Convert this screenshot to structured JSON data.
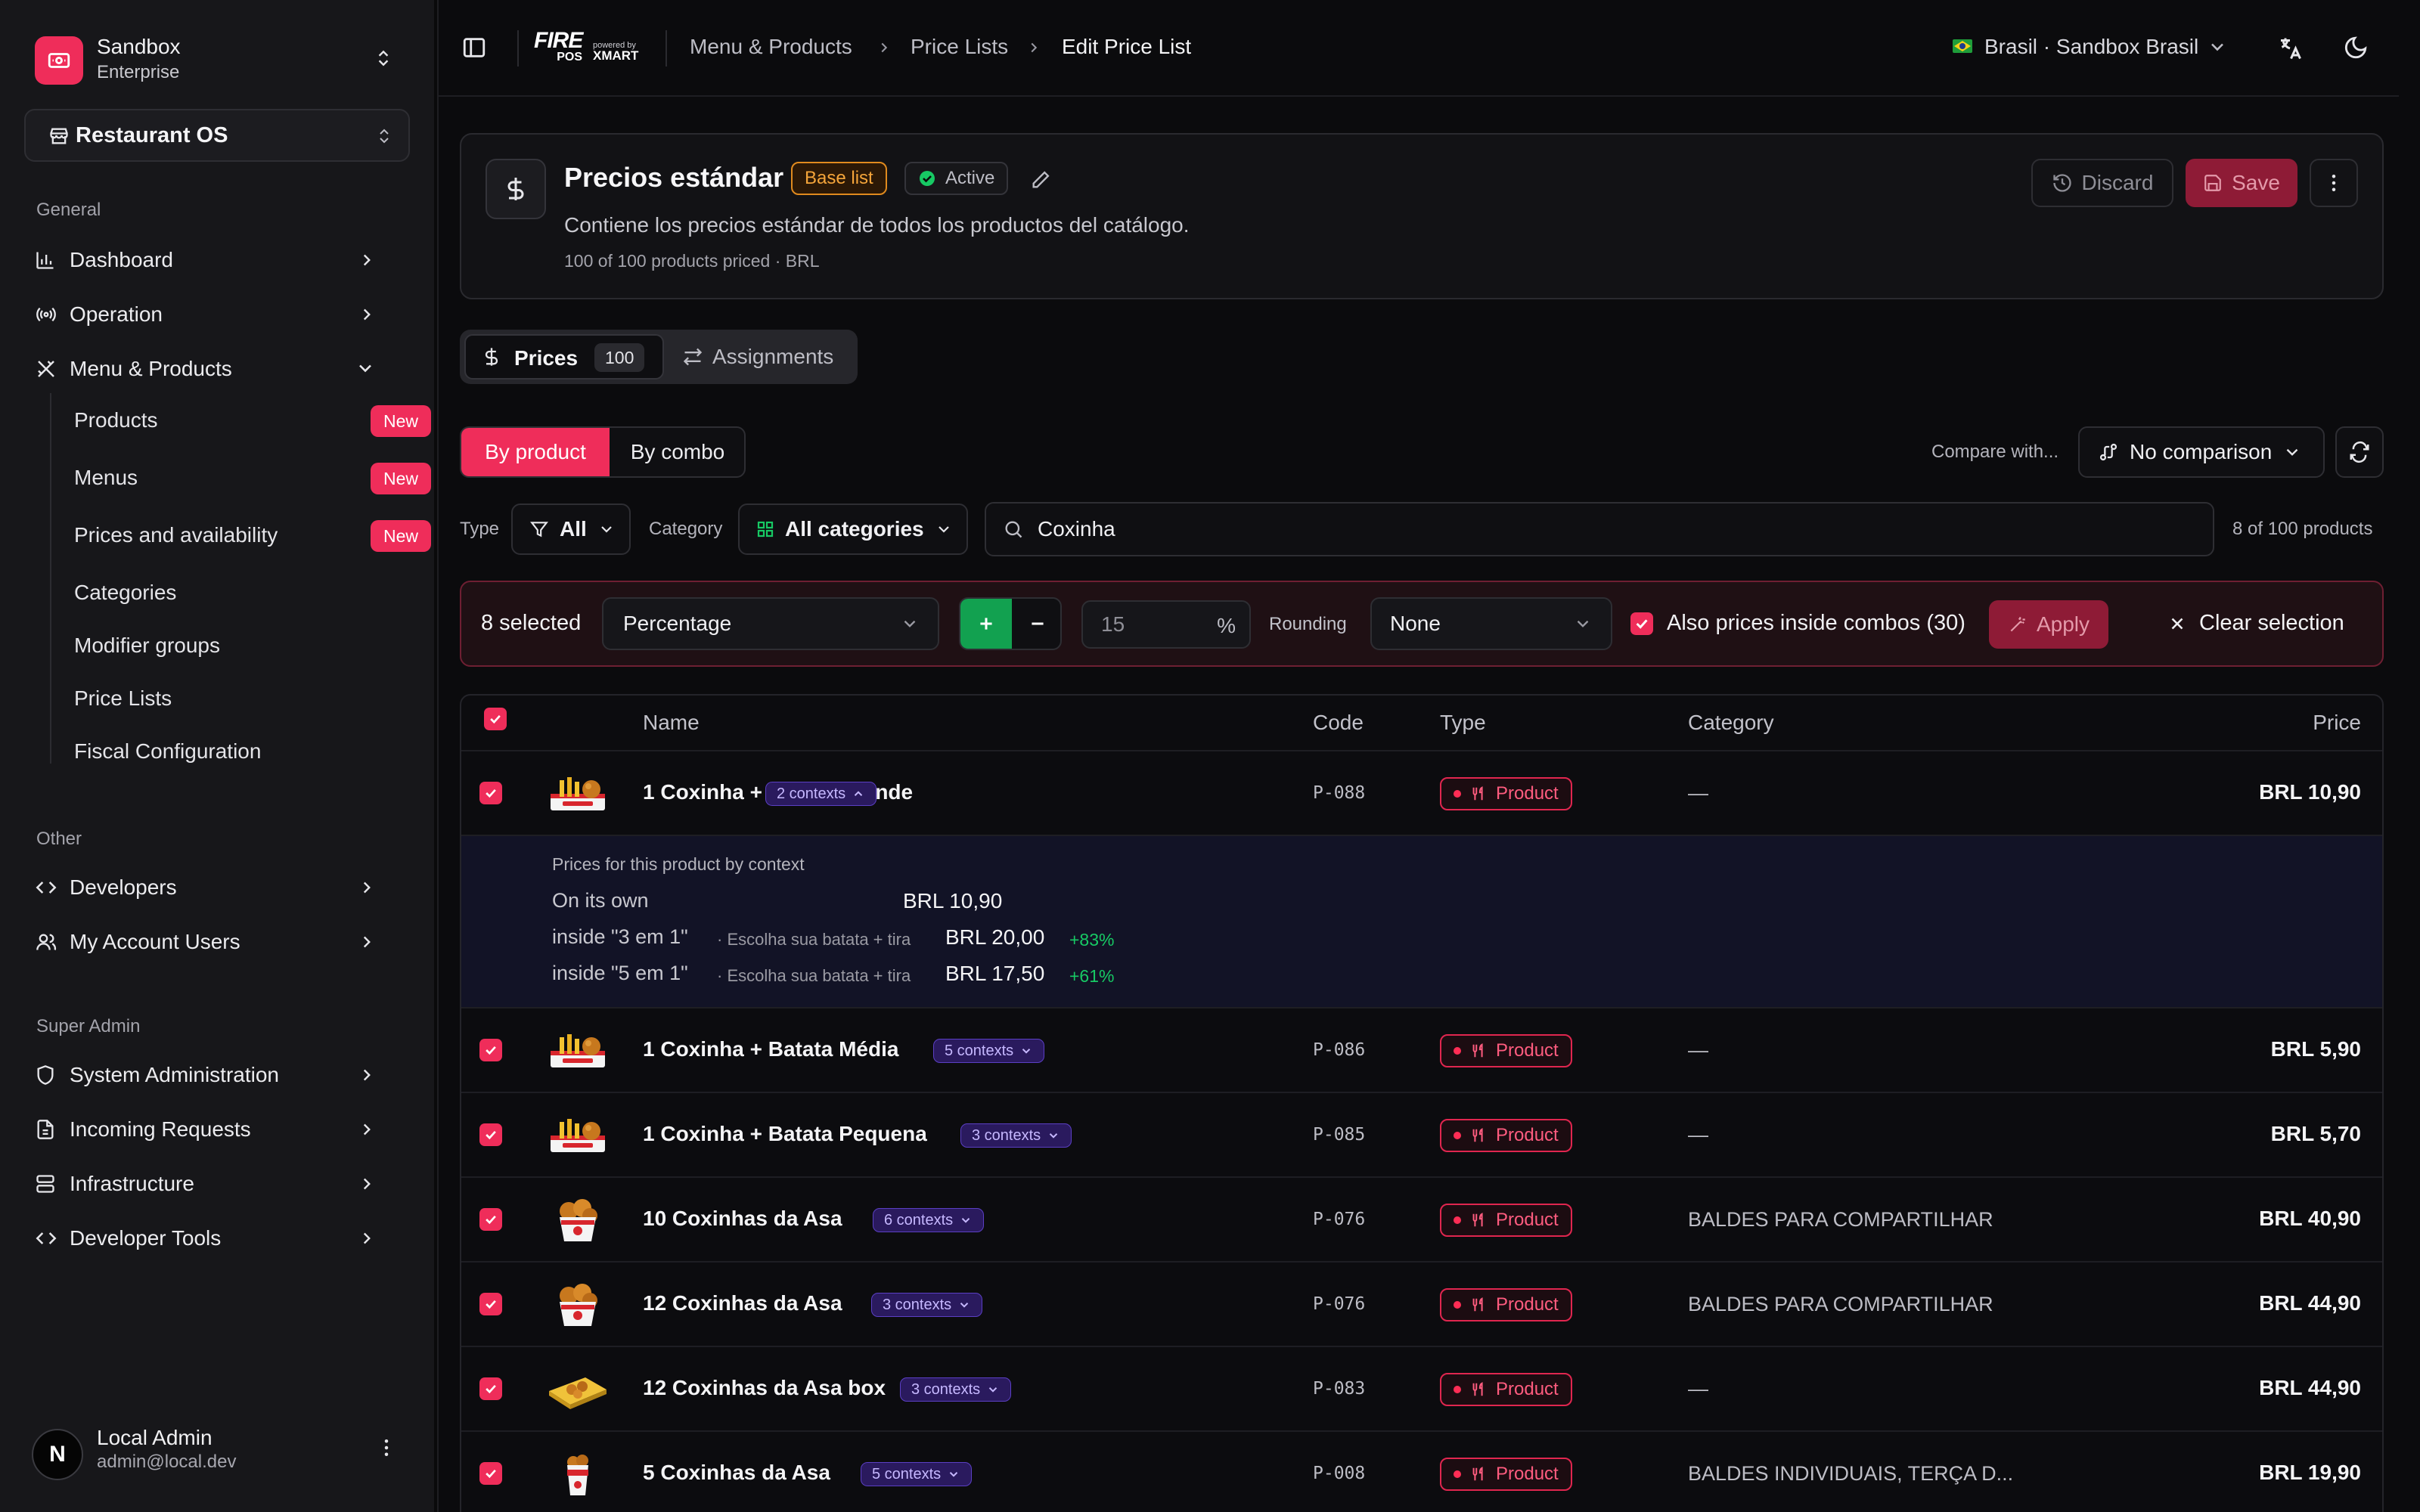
{
  "sidebar": {
    "org": {
      "name": "Sandbox",
      "plan": "Enterprise"
    },
    "workspace": "Restaurant OS",
    "sections": {
      "general": "General",
      "other": "Other",
      "super_admin": "Super Admin"
    },
    "general_items": [
      {
        "label": "Dashboard",
        "icon": "bar-chart-icon"
      },
      {
        "label": "Operation",
        "icon": "radio-icon"
      },
      {
        "label": "Menu & Products",
        "icon": "utensils-icon"
      }
    ],
    "menu_sub_items": [
      {
        "label": "Products",
        "badge": "New"
      },
      {
        "label": "Menus",
        "badge": "New"
      },
      {
        "label": "Prices and availability",
        "badge": "New"
      },
      {
        "label": "Categories"
      },
      {
        "label": "Modifier groups"
      },
      {
        "label": "Price Lists"
      },
      {
        "label": "Fiscal Configuration"
      }
    ],
    "other_items": [
      {
        "label": "Developers",
        "icon": "code-icon"
      },
      {
        "label": "My Account Users",
        "icon": "users-icon"
      }
    ],
    "admin_items": [
      {
        "label": "System Administration",
        "icon": "shield-icon"
      },
      {
        "label": "Incoming Requests",
        "icon": "file-icon"
      },
      {
        "label": "Infrastructure",
        "icon": "server-icon"
      },
      {
        "label": "Developer Tools",
        "icon": "code-icon"
      }
    ],
    "user": {
      "initial": "N",
      "name": "Local Admin",
      "email": "admin@local.dev"
    }
  },
  "topbar": {
    "logo_text": "FIRE",
    "logo_sub": "POS",
    "powered_by": "powered by",
    "partner": "XMART",
    "breadcrumb": [
      "Menu & Products",
      "Price Lists",
      "Edit Price List"
    ],
    "region": "Brasil · Sandbox Brasil"
  },
  "header": {
    "title": "Precios estándar",
    "base_badge": "Base list",
    "status": "Active",
    "description": "Contiene los precios estándar de todos los productos del catálogo.",
    "meta": "100 of 100 products priced · BRL",
    "discard": "Discard",
    "save": "Save"
  },
  "tabs": {
    "prices": "Prices",
    "prices_count": "100",
    "assignments": "Assignments"
  },
  "view": {
    "by_product": "By product",
    "by_combo": "By combo",
    "compare_label": "Compare with...",
    "compare_value": "No comparison"
  },
  "filters": {
    "type_label": "Type",
    "type_value": "All",
    "category_label": "Category",
    "category_value": "All categories",
    "search_value": "Coxinha",
    "count": "8 of 100 products"
  },
  "bulk": {
    "selected": "8 selected",
    "mode": "Percentage",
    "amount": "15",
    "unit": "%",
    "rounding_label": "Rounding",
    "rounding_value": "None",
    "combos_label": "Also prices inside combos (30)",
    "apply": "Apply",
    "clear": "Clear selection"
  },
  "table": {
    "headers": {
      "name": "Name",
      "code": "Code",
      "type": "Type",
      "category": "Category",
      "price": "Price"
    },
    "type_label": "Product",
    "rows": [
      {
        "name": "1 Coxinha + Batata Grande",
        "contexts": "2 contexts",
        "code": "P-088",
        "category": "—",
        "price": "BRL 10,90",
        "thumb": "box"
      },
      {
        "name": "1 Coxinha + Batata Média",
        "contexts": "5 contexts",
        "code": "P-086",
        "category": "—",
        "price": "BRL 5,90",
        "thumb": "box"
      },
      {
        "name": "1 Coxinha + Batata Pequena",
        "contexts": "3 contexts",
        "code": "P-085",
        "category": "—",
        "price": "BRL 5,70",
        "thumb": "box"
      },
      {
        "name": "10 Coxinhas da Asa",
        "contexts": "6 contexts",
        "code": "P-076",
        "category": "BALDES PARA COMPARTILHAR",
        "price": "BRL 40,90",
        "thumb": "bucket"
      },
      {
        "name": "12 Coxinhas da Asa",
        "contexts": "3 contexts",
        "code": "P-076",
        "category": "BALDES PARA COMPARTILHAR",
        "price": "BRL 44,90",
        "thumb": "bucket"
      },
      {
        "name": "12 Coxinhas da Asa box",
        "contexts": "3 contexts",
        "code": "P-083",
        "category": "—",
        "price": "BRL 44,90",
        "thumb": "tray"
      },
      {
        "name": "5 Coxinhas da Asa",
        "contexts": "5 contexts",
        "code": "P-008",
        "category": "BALDES INDIVIDUAIS, TERÇA D...",
        "price": "BRL 19,90",
        "thumb": "cup"
      }
    ],
    "expanded": {
      "title": "Prices for this product by context",
      "lines": [
        {
          "label": "On its own",
          "sub": "",
          "price": "BRL 10,90",
          "delta": ""
        },
        {
          "label": "inside \"3 em 1\"",
          "sub": "· Escolha sua batata + tira",
          "price": "BRL 20,00",
          "delta": "+83%"
        },
        {
          "label": "inside \"5 em 1\"",
          "sub": "· Escolha sua batata + tira",
          "price": "BRL 17,50",
          "delta": "+61%"
        }
      ]
    }
  },
  "colors": {
    "accent": "#ef2d5a",
    "green": "#12a150",
    "context": "#5b3fc4"
  }
}
